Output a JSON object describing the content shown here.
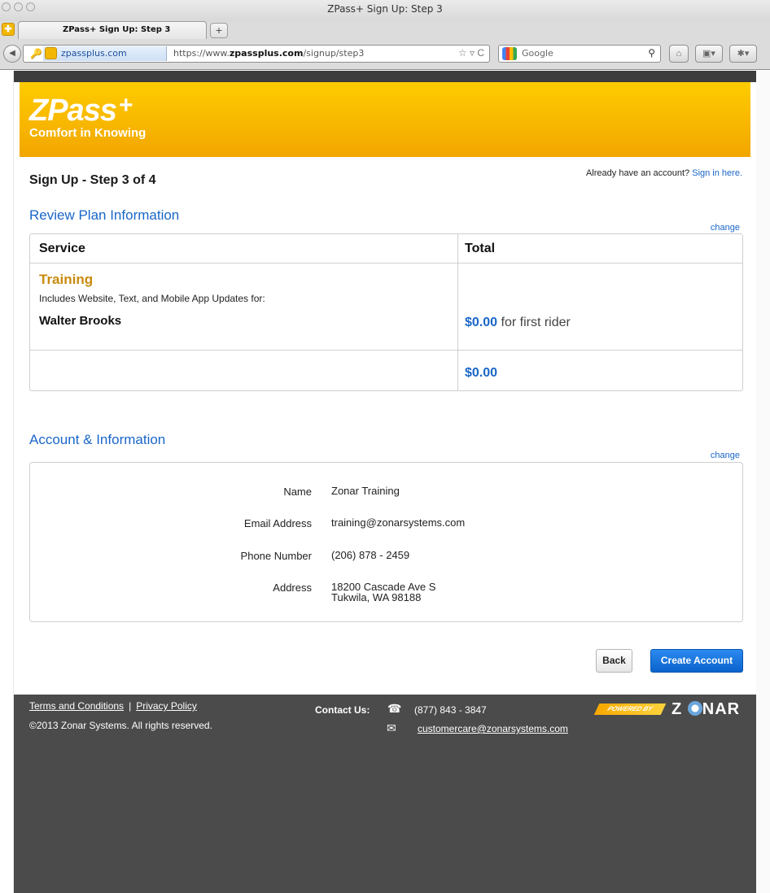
{
  "browser": {
    "window_title": "ZPass+ Sign Up: Step 3",
    "tab_label": "ZPass+ Sign Up: Step 3",
    "newtab_label": "+",
    "site_identity": "zpassplus.com",
    "url_prefix": "https://www.",
    "url_domain": "zpassplus.com",
    "url_path": "/signup/step3",
    "url_icons": "☆ ▿ C",
    "search_engine_label": "Google",
    "icons": [
      "back-arrow-icon",
      "key-icon",
      "favicon",
      "star-icon",
      "reload-icon",
      "google-icon",
      "search-icon",
      "home-icon",
      "bookmark-icon",
      "addon-icon"
    ]
  },
  "logo": {
    "name": "ZPass",
    "plus": "+",
    "tagline": "Comfort in Knowing"
  },
  "page": {
    "step_title": "Sign Up - Step 3 of 4",
    "signin_prompt": "Already have an account?",
    "signin_link": "Sign in here."
  },
  "plan": {
    "section_title": "Review Plan Information",
    "change_label": "change",
    "col_service": "Service",
    "col_total": "Total",
    "plan_name": "Training",
    "plan_desc": "Includes Website, Text, and Mobile App Updates for:",
    "rider_name": "Walter Brooks",
    "rider_price": "$0.00",
    "rider_price_suffix": "for first rider",
    "total": "$0.00"
  },
  "account": {
    "section_title": "Account & Information",
    "change_label": "change",
    "fields": [
      {
        "label": "Name",
        "value": "Zonar Training"
      },
      {
        "label": "Email Address",
        "value": "training@zonarsystems.com"
      },
      {
        "label": "Phone Number",
        "value": "(206) 878 - 2459"
      },
      {
        "label": "Address",
        "value": "18200 Cascade Ave S",
        "value2": "Tukwila, WA 98188"
      }
    ]
  },
  "actions": {
    "back": "Back",
    "create": "Create Account"
  },
  "footer": {
    "terms": "Terms and Conditions",
    "separator": "|",
    "privacy": "Privacy Policy",
    "copyright": "©2013 Zonar Systems. All rights reserved.",
    "contact_label": "Contact Us:",
    "phone": "(877) 843 - 3847",
    "email": "customercare@zonarsystems.com",
    "powered_by": "POWERED BY",
    "brand_left": "Z",
    "brand_right": "NAR"
  },
  "colors": {
    "accent_blue": "#1a66c8",
    "plan_gold": "#c98a0d",
    "header_yellow": "#ffcc00",
    "footer_gray": "#4b4b4b"
  }
}
